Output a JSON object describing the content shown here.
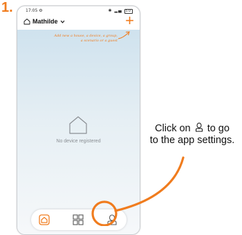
{
  "accent": "#f07c1e",
  "step": "1.",
  "status": {
    "time": "17:05",
    "battery": "50"
  },
  "header": {
    "home_name": "Mathilde",
    "add_label": "+"
  },
  "hint": {
    "line1": "Add new a house, a device, a group,",
    "line2": "a scenario or a guest"
  },
  "empty_state": {
    "label": "No device registered"
  },
  "bottom_nav": {
    "items": [
      {
        "name": "home",
        "icon": "home-icon",
        "active": true
      },
      {
        "name": "devices",
        "icon": "grid-icon",
        "active": false
      },
      {
        "name": "profile",
        "icon": "user-icon",
        "active": false
      }
    ]
  },
  "callout": {
    "before": "Click on",
    "icon": "user-icon",
    "after_line1": "to go",
    "line2": "to the app settings."
  }
}
